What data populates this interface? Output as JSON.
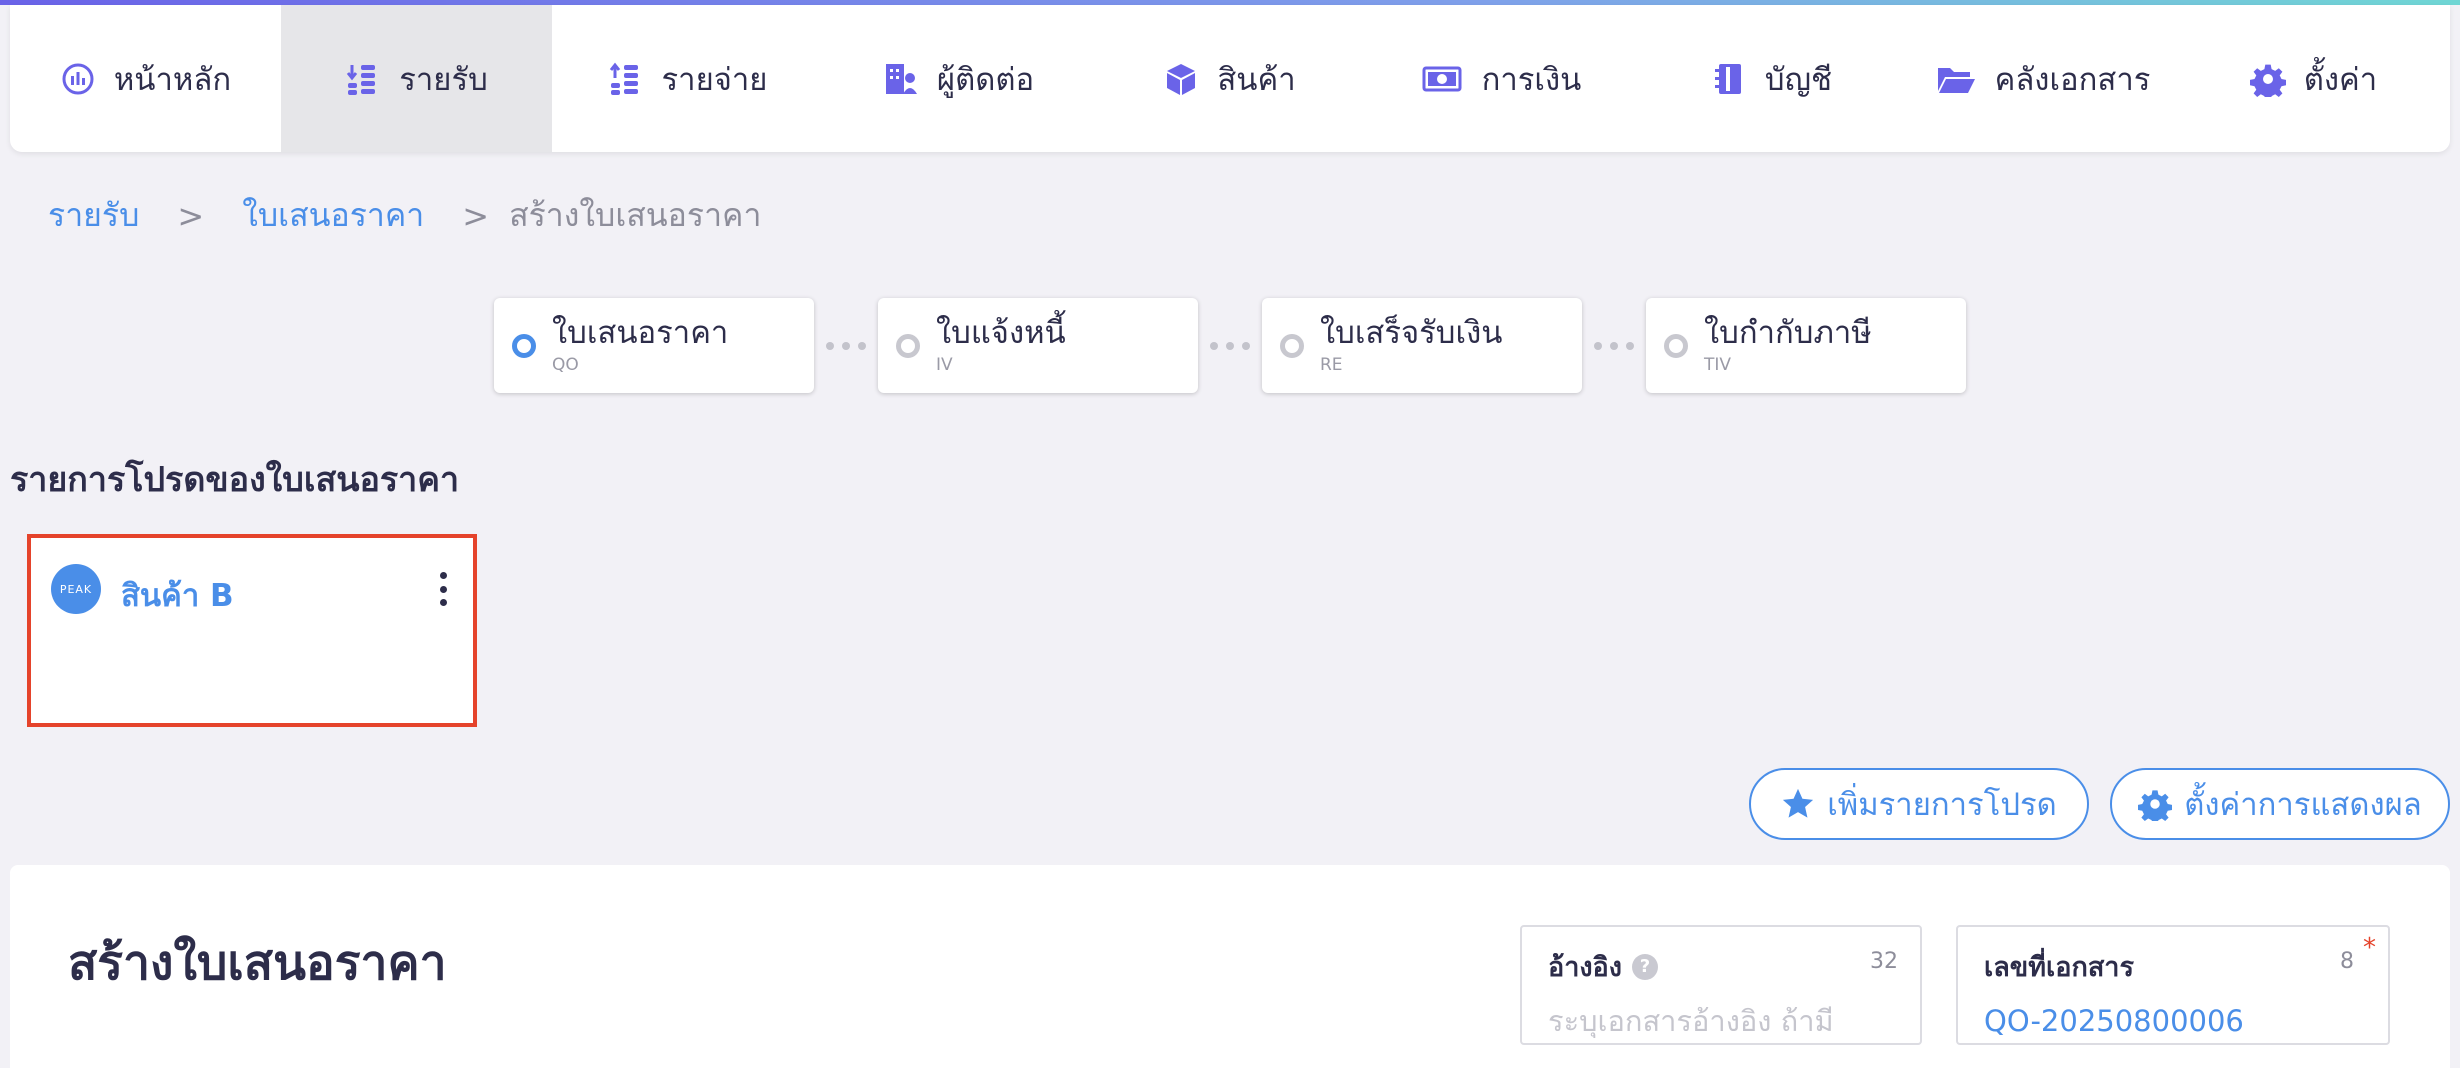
{
  "nav": {
    "items": [
      {
        "label": "หน้าหลัก",
        "icon": "dashboard-icon"
      },
      {
        "label": "รายรับ",
        "icon": "income-icon",
        "active": true
      },
      {
        "label": "รายจ่าย",
        "icon": "expense-icon"
      },
      {
        "label": "ผู้ติดต่อ",
        "icon": "contacts-icon"
      },
      {
        "label": "สินค้า",
        "icon": "product-box-icon"
      },
      {
        "label": "การเงิน",
        "icon": "money-icon"
      },
      {
        "label": "บัญชี",
        "icon": "account-book-icon"
      },
      {
        "label": "คลังเอกสาร",
        "icon": "folder-icon"
      },
      {
        "label": "ตั้งค่า",
        "icon": "gear-icon"
      }
    ]
  },
  "breadcrumb": {
    "items": [
      "รายรับ",
      "ใบเสนอราคา",
      "สร้างใบเสนอราคา"
    ],
    "separator": ">"
  },
  "flow": {
    "steps": [
      {
        "title": "ใบเสนอราคา",
        "code": "QO",
        "active": true
      },
      {
        "title": "ใบแจ้งหนี้",
        "code": "IV",
        "active": false
      },
      {
        "title": "ใบเสร็จรับเงิน",
        "code": "RE",
        "active": false
      },
      {
        "title": "ใบกำกับภาษี",
        "code": "TIV",
        "active": false
      }
    ]
  },
  "favorites": {
    "title": "รายการโปรดของใบเสนอราคา",
    "items": [
      {
        "name": "สินค้า B",
        "logo_text": "PEAK"
      }
    ]
  },
  "actions": {
    "add_favorite": "เพิ่มรายการโปรด",
    "display_settings": "ตั้งค่าการแสดงผล"
  },
  "form": {
    "title": "สร้างใบเสนอราคา",
    "reference": {
      "label": "อ้างอิง",
      "help": "?",
      "count": "32",
      "placeholder": "ระบุเอกสารอ้างอิง ถ้ามี",
      "value": ""
    },
    "document_no": {
      "label": "เลขที่เอกสาร",
      "count": "8",
      "required_mark": "*",
      "value": "QO-20250800006"
    }
  },
  "colors": {
    "accent": "#4a8ee8",
    "nav_icon": "#6a63e8",
    "highlight_border": "#e5432b",
    "background": "#f2f1f6"
  }
}
